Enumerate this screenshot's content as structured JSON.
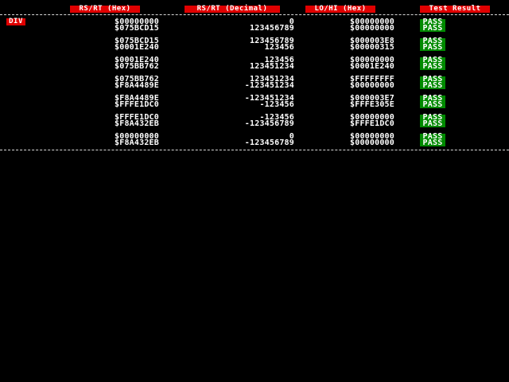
{
  "headers": {
    "rs_rt_hex": "RS/RT (Hex)",
    "rs_rt_dec": "RS/RT (Decimal)",
    "lo_hi_hex": "LO/HI (Hex)",
    "result": "Test Result"
  },
  "operation": "DIV",
  "rows": [
    {
      "rs_hex": "$00000000",
      "rt_hex": "$075BCD15",
      "rs_dec": "0",
      "rt_dec": "123456789",
      "lo_hex": "$00000000",
      "hi_hex": "$00000000",
      "res1": "PASS",
      "res2": "PASS"
    },
    {
      "rs_hex": "$075BCD15",
      "rt_hex": "$0001E240",
      "rs_dec": "123456789",
      "rt_dec": "123456",
      "lo_hex": "$000003E8",
      "hi_hex": "$00000315",
      "res1": "PASS",
      "res2": "PASS"
    },
    {
      "rs_hex": "$0001E240",
      "rt_hex": "$075BB762",
      "rs_dec": "123456",
      "rt_dec": "123451234",
      "lo_hex": "$00000000",
      "hi_hex": "$0001E240",
      "res1": "PASS",
      "res2": "PASS"
    },
    {
      "rs_hex": "$075BB762",
      "rt_hex": "$F8A4489E",
      "rs_dec": "123451234",
      "rt_dec": "-123451234",
      "lo_hex": "$FFFFFFFF",
      "hi_hex": "$00000000",
      "res1": "PASS",
      "res2": "PASS"
    },
    {
      "rs_hex": "$F8A4489E",
      "rt_hex": "$FFFE1DC0",
      "rs_dec": "-123451234",
      "rt_dec": "-123456",
      "lo_hex": "$000003E7",
      "hi_hex": "$FFFE305E",
      "res1": "PASS",
      "res2": "PASS"
    },
    {
      "rs_hex": "$FFFE1DC0",
      "rt_hex": "$F8A432EB",
      "rs_dec": "-123456",
      "rt_dec": "-123456789",
      "lo_hex": "$00000000",
      "hi_hex": "$FFFE1DC0",
      "res1": "PASS",
      "res2": "PASS"
    },
    {
      "rs_hex": "$00000000",
      "rt_hex": "$F8A432EB",
      "rs_dec": "0",
      "rt_dec": "-123456789",
      "lo_hex": "$00000000",
      "hi_hex": "$00000000",
      "res1": "PASS",
      "res2": "PASS"
    }
  ]
}
